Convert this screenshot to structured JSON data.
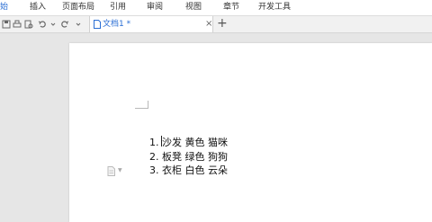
{
  "menubar": {
    "items": [
      "始",
      "插入",
      "页面布局",
      "引用",
      "审阅",
      "视图",
      "章节",
      "开发工具"
    ]
  },
  "tab": {
    "title": "文档1 *",
    "close": "×"
  },
  "new_tab": "+",
  "list": {
    "items": [
      {
        "num": "1.",
        "text": "沙发  黄色  猫咪"
      },
      {
        "num": "2.",
        "text": "板凳  绿色  狗狗"
      },
      {
        "num": "3.",
        "text": "衣柜  白色  云朵"
      }
    ]
  },
  "colors": {
    "accent": "#2a6ed4",
    "page": "#ffffff",
    "workspace": "#e6e6e6"
  },
  "icons": [
    "save-icon",
    "print-icon",
    "print-preview-icon",
    "undo-icon",
    "redo-icon",
    "dropdown-arrow-icon",
    "document-icon",
    "paragraph-marker-icon"
  ]
}
